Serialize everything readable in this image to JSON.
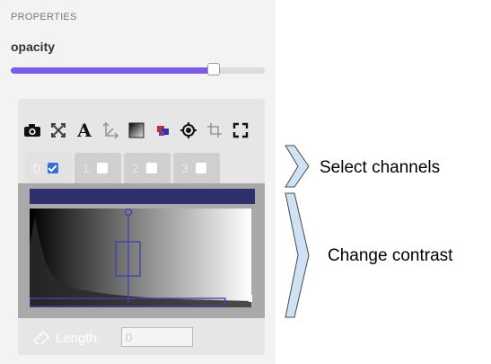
{
  "panel": {
    "section_title": "PROPERTIES",
    "property_label": "opacity",
    "opacity_fraction": 0.8
  },
  "toolbar": {
    "icons": [
      "camera-icon",
      "fit-view-icon",
      "text-icon",
      "axes-icon",
      "gradient-icon",
      "color-blocks-icon",
      "crosshair-target-icon",
      "crop-icon",
      "fullscreen-icon"
    ],
    "text_tool_glyph": "A"
  },
  "channels": {
    "tabs": [
      {
        "label": "0",
        "checked": true,
        "active": true
      },
      {
        "label": "1",
        "checked": false,
        "active": false
      },
      {
        "label": "2",
        "checked": false,
        "active": false
      },
      {
        "label": "3",
        "checked": false,
        "active": false
      }
    ],
    "color": "#2f2f6e"
  },
  "measure": {
    "length_label": "Length:",
    "length_value": "0"
  },
  "annotations": {
    "select_channels": "Select channels",
    "change_contrast": "Change contrast"
  },
  "colors": {
    "accent": "#7b5ce6",
    "channel_box": "#4444aa",
    "brace_fill": "#cfe2f3",
    "brace_stroke": "#4a4a4a"
  }
}
